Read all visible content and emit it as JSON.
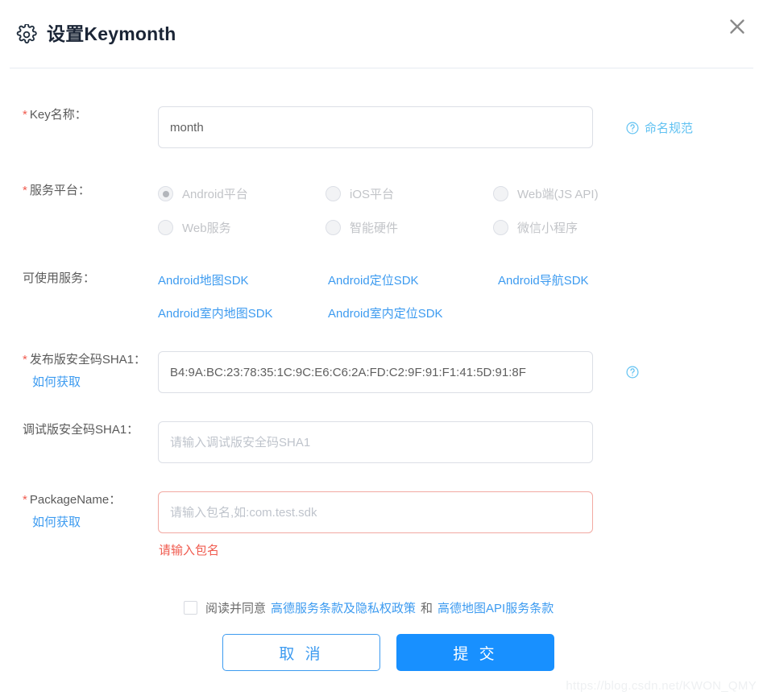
{
  "header": {
    "title": "设置Keymonth",
    "gear_icon": "gear-icon",
    "close_icon": "close-icon"
  },
  "form": {
    "key_name": {
      "label": "Key名称：",
      "required": true,
      "value": "month",
      "hint_text": "命名规范",
      "hint_icon": "question-circle-icon"
    },
    "platform": {
      "label": "服务平台：",
      "required": true,
      "options": [
        {
          "label": "Android平台",
          "selected": true,
          "disabled": true
        },
        {
          "label": "iOS平台",
          "selected": false,
          "disabled": true
        },
        {
          "label": "Web端(JS API)",
          "selected": false,
          "disabled": true
        },
        {
          "label": "Web服务",
          "selected": false,
          "disabled": true
        },
        {
          "label": "智能硬件",
          "selected": false,
          "disabled": true
        },
        {
          "label": "微信小程序",
          "selected": false,
          "disabled": true
        }
      ]
    },
    "services": {
      "label": "可使用服务：",
      "items": [
        "Android地图SDK",
        "Android定位SDK",
        "Android导航SDK",
        "Android室内地图SDK",
        "Android室内定位SDK"
      ]
    },
    "release_sha1": {
      "label": "发布版安全码SHA1：",
      "required": true,
      "sub_link": "如何获取",
      "value": "B4:9A:BC:23:78:35:1C:9C:E6:C6:2A:FD:C2:9F:91:F1:41:5D:91:8F",
      "hint_icon": "question-circle-icon"
    },
    "debug_sha1": {
      "label": "调试版安全码SHA1：",
      "required": false,
      "value": "",
      "placeholder": "请输入调试版安全码SHA1"
    },
    "package_name": {
      "label": "PackageName：",
      "required": true,
      "sub_link": "如何获取",
      "value": "",
      "placeholder": "请输入包名,如:com.test.sdk",
      "error": "请输入包名"
    }
  },
  "agreement": {
    "checked": false,
    "prefix": "阅读并同意",
    "link1": "高德服务条款及隐私权政策",
    "conjunction": "和",
    "link2": "高德地图API服务条款"
  },
  "footer": {
    "cancel_label": "取 消",
    "submit_label": "提 交"
  },
  "watermark": "https://blog.csdn.net/KWON_QMY",
  "colors": {
    "accent": "#1890ff",
    "link": "#3d9bf0",
    "hint": "#61c2f2",
    "error": "#f05b4f",
    "required": "#f05b4f",
    "border": "#dcdfe6",
    "title": "#1b2536"
  }
}
